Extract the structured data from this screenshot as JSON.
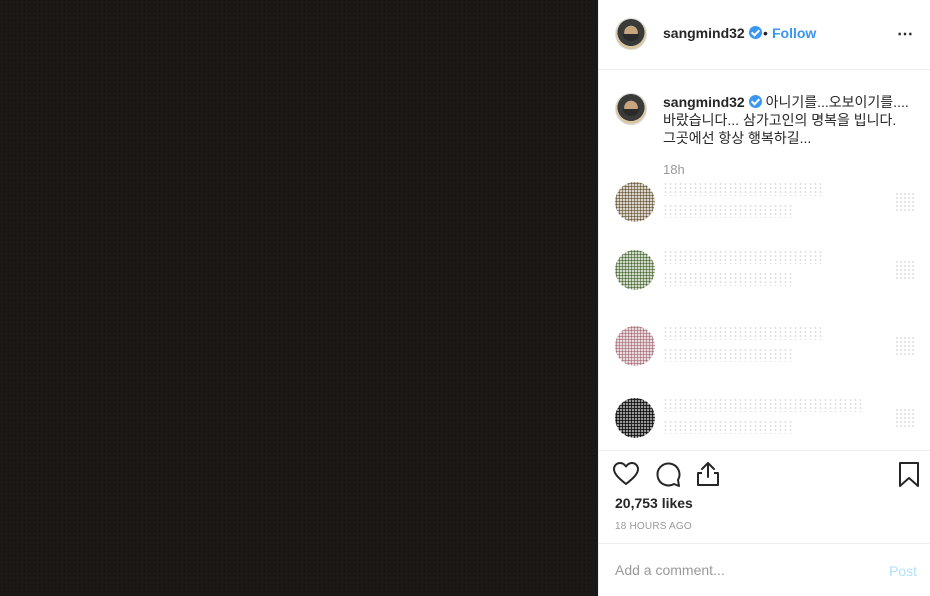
{
  "post": {
    "username": "sangmind32",
    "dot": "•",
    "follow_label": "Follow",
    "more_icon": "⋯",
    "caption_username": "sangmind32",
    "caption_text": "아니기를...오보이기를.... 바랐습니다... 삼가고인의 명복을 빕니다. 그곳에선 항상 행복하길...",
    "time": "18h",
    "likes": "20,753 likes",
    "time_ago": "18 HOURS AGO"
  },
  "comment": {
    "placeholder": "Add a comment...",
    "post_label": "Post"
  },
  "colors": {
    "accent": "#3897f0",
    "post_disabled": "#b2dffc",
    "media_bg": "#1a1714"
  },
  "blurred_comments": [
    {
      "avatar_color": "#6b5a3a"
    },
    {
      "avatar_color": "#4d6b34"
    },
    {
      "avatar_color": "#a8707a"
    },
    {
      "avatar_color": "#111111"
    }
  ]
}
